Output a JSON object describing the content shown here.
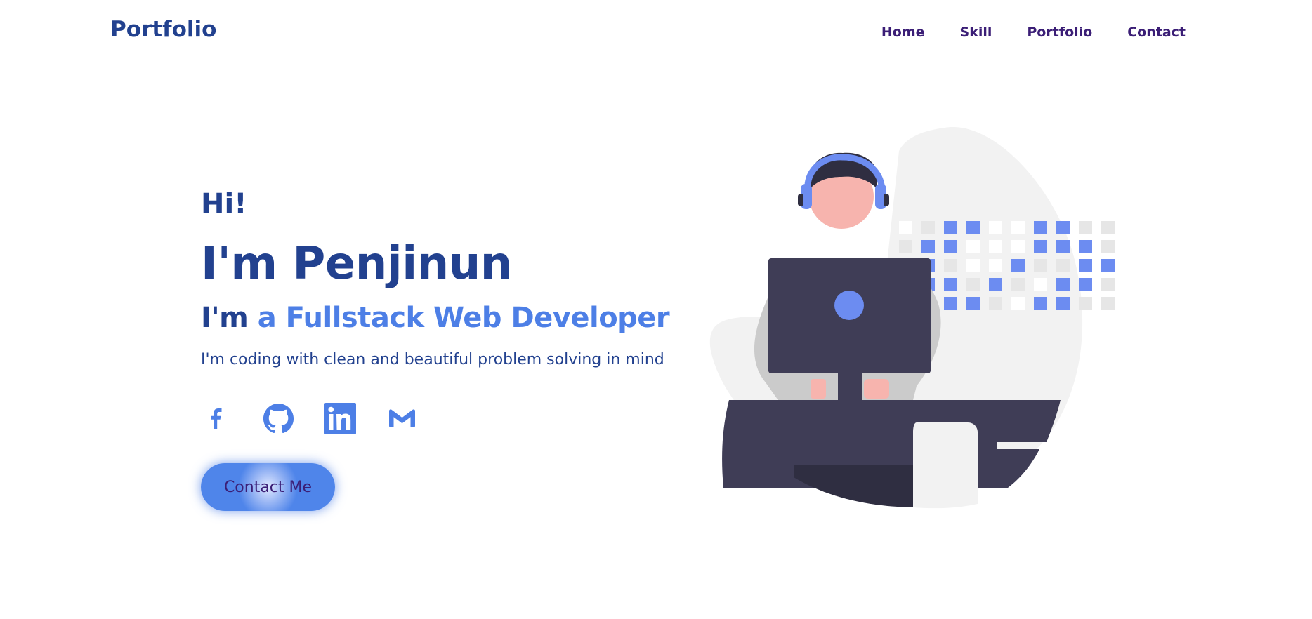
{
  "nav": {
    "brand": "Portfolio",
    "links": [
      "Home",
      "Skill",
      "Portfolio",
      "Contact"
    ]
  },
  "hero": {
    "greeting": "Hi!",
    "name": "I'm Penjinun",
    "role_prefix": "I'm",
    "role_accent": "a Fullstack Web Developer",
    "tagline": "I'm coding with clean and beautiful problem solving in mind"
  },
  "socials": [
    {
      "icon": "facebook-icon"
    },
    {
      "icon": "github-icon"
    },
    {
      "icon": "linkedin-icon"
    },
    {
      "icon": "gmail-icon"
    }
  ],
  "cta": {
    "label": "Contact Me"
  },
  "colors": {
    "primary": "#22418f",
    "accent": "#4d7fe6",
    "nav_text": "#3b1e76",
    "illustration_dark": "#3f3d56",
    "illustration_skin": "#f7b4ae",
    "illustration_grey": "#f2f2f2"
  }
}
